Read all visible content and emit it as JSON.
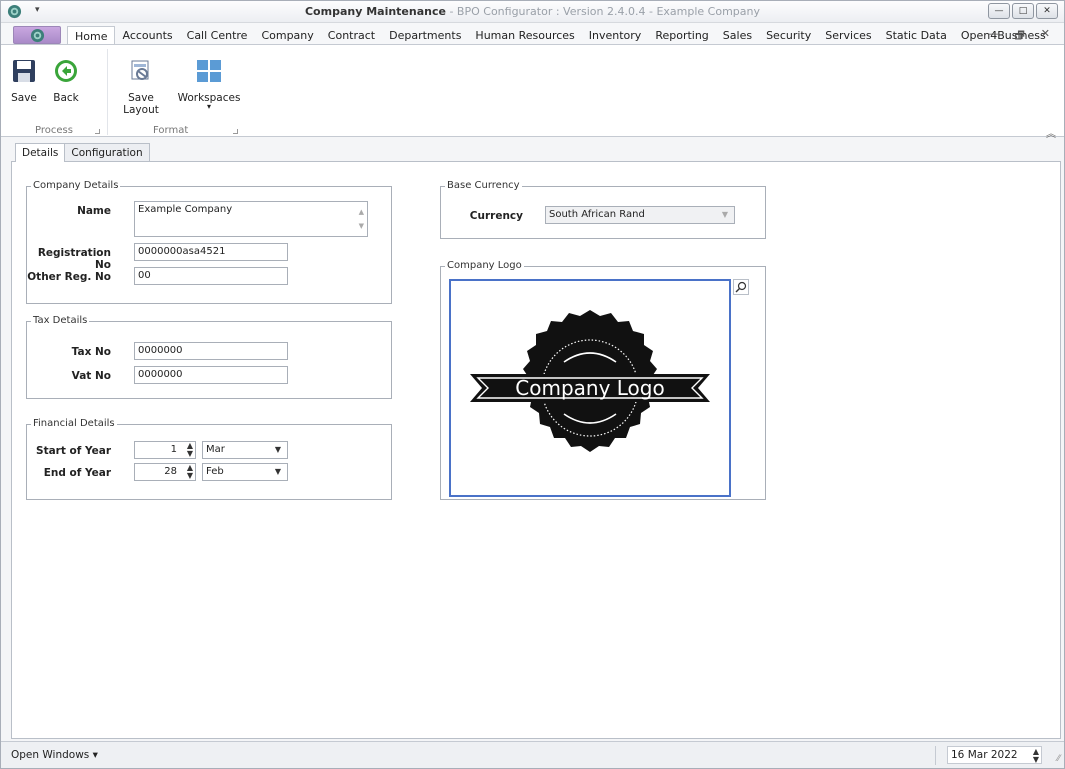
{
  "window": {
    "title_bold": "Company Maintenance",
    "title_rest": " - BPO Configurator : Version 2.4.0.4 - Example Company",
    "minimize": "—",
    "maximize": "□",
    "close": "✕"
  },
  "ribbon": {
    "tabs": [
      "Home",
      "Accounts",
      "Call Centre",
      "Company",
      "Contract",
      "Departments",
      "Human Resources",
      "Inventory",
      "Reporting",
      "Sales",
      "Security",
      "Services",
      "Static Data",
      "Open4Business"
    ],
    "active_tab": "Home",
    "buttons": {
      "save": "Save",
      "back": "Back",
      "save_layout": "Save Layout",
      "workspaces": "Workspaces"
    },
    "groups": {
      "process": "Process",
      "format": "Format"
    },
    "mdi": {
      "minimize": "—",
      "restore": "🗗",
      "close": "✕"
    }
  },
  "page_tabs": [
    "Details",
    "Configuration"
  ],
  "company_details": {
    "legend": "Company Details",
    "name_label": "Name",
    "name_value": "Example Company",
    "reg_label": "Registration No",
    "reg_value": "0000000asa4521",
    "other_reg_label": "Other Reg. No",
    "other_reg_value": "00"
  },
  "tax_details": {
    "legend": "Tax Details",
    "tax_label": "Tax No",
    "tax_value": "0000000",
    "vat_label": "Vat No",
    "vat_value": "0000000"
  },
  "financial_details": {
    "legend": "Financial Details",
    "start_label": "Start of Year",
    "start_day": "1",
    "start_month": "Mar",
    "end_label": "End of Year",
    "end_day": "28",
    "end_month": "Feb"
  },
  "base_currency": {
    "legend": "Base Currency",
    "currency_label": "Currency",
    "currency_value": "South African Rand"
  },
  "company_logo": {
    "legend": "Company Logo",
    "logo_text": "Company Logo"
  },
  "statusbar": {
    "open_windows": "Open Windows ▾",
    "date": "16 Mar 2022"
  },
  "colors": {
    "accent": "#4a72c8",
    "save_icon": "#2f3f5e",
    "back_icon": "#3aa53a",
    "workspaces_icon": "#5b9bd5"
  }
}
